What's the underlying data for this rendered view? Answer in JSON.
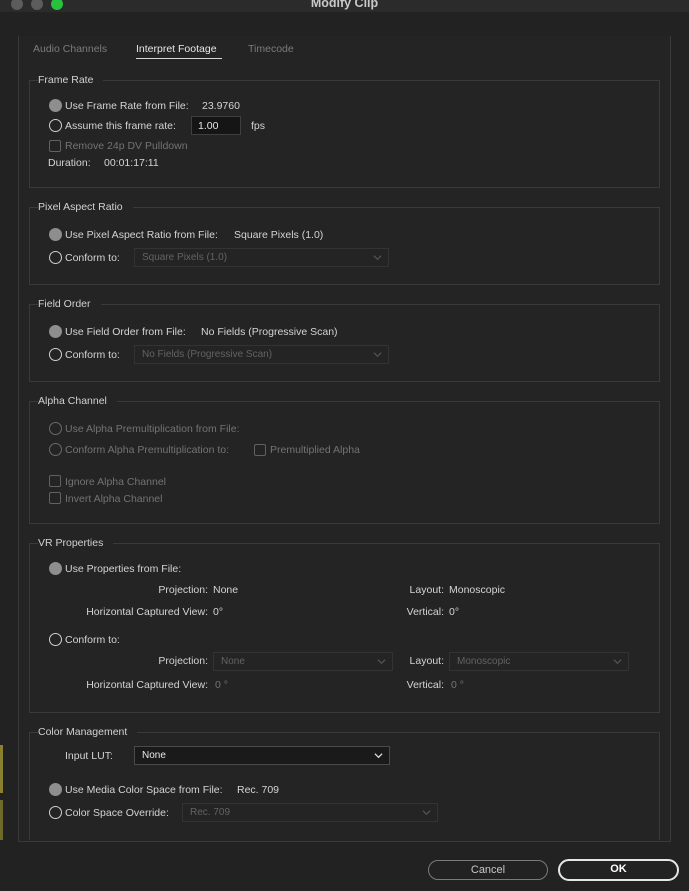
{
  "window": {
    "title": "Modify Clip"
  },
  "tabs": [
    "Audio Channels",
    "Interpret Footage",
    "Timecode"
  ],
  "frame_rate": {
    "legend": "Frame Rate",
    "use_from_file_label": "Use Frame Rate from File:",
    "use_from_file_value": "23.9760",
    "assume_label": "Assume this frame rate:",
    "assume_value": "1.00",
    "assume_unit": "fps",
    "remove_pulldown_label": "Remove 24p DV Pulldown",
    "duration_label": "Duration:",
    "duration_value": "00:01:17:11"
  },
  "pixel_aspect": {
    "legend": "Pixel Aspect Ratio",
    "use_from_file_label": "Use Pixel Aspect Ratio from File:",
    "use_from_file_value": "Square Pixels (1.0)",
    "conform_label": "Conform to:",
    "conform_value": "Square Pixels (1.0)"
  },
  "field_order": {
    "legend": "Field Order",
    "use_from_file_label": "Use Field Order from File:",
    "use_from_file_value": "No Fields (Progressive Scan)",
    "conform_label": "Conform to:",
    "conform_value": "No Fields (Progressive Scan)"
  },
  "alpha": {
    "legend": "Alpha Channel",
    "use_from_file_label": "Use Alpha Premultiplication from File:",
    "conform_label": "Conform Alpha Premultiplication to:",
    "premultiplied_label": "Premultiplied Alpha",
    "ignore_label": "Ignore Alpha Channel",
    "invert_label": "Invert Alpha Channel"
  },
  "vr": {
    "legend": "VR Properties",
    "use_from_file_label": "Use Properties from File:",
    "projection_label": "Projection:",
    "projection_value": "None",
    "layout_label": "Layout:",
    "layout_value": "Monoscopic",
    "hcv_label": "Horizontal Captured View:",
    "hcv_value": "0°",
    "vertical_label": "Vertical:",
    "vertical_value": "0°",
    "conform_label": "Conform to:",
    "conform_projection_value": "None",
    "conform_layout_value": "Monoscopic",
    "conform_hcv_value": "0 °",
    "conform_vertical_value": "0 °"
  },
  "color": {
    "legend": "Color Management",
    "input_lut_label": "Input LUT:",
    "input_lut_value": "None",
    "use_media_label": "Use Media Color Space from File:",
    "use_media_value": "Rec. 709",
    "override_label": "Color Space Override:",
    "override_value": "Rec. 709"
  },
  "buttons": {
    "cancel": "Cancel",
    "ok": "OK"
  },
  "colors": {
    "background": "#222222",
    "traffic_close": "#5c5c5c",
    "traffic_min": "#5c5c5c",
    "traffic_zoom": "#29c23f"
  }
}
